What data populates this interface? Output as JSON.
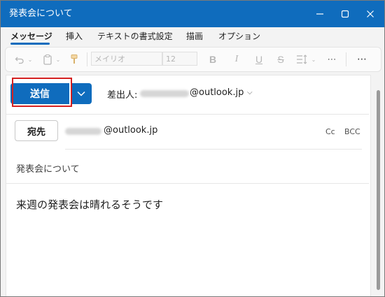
{
  "window": {
    "title": "発表会について",
    "controls": [
      "minimize-icon",
      "maximize-icon",
      "close-icon"
    ]
  },
  "menu": {
    "tabs": [
      {
        "label": "メッセージ",
        "active": true
      },
      {
        "label": "挿入"
      },
      {
        "label": "テキストの書式設定"
      },
      {
        "label": "描画"
      },
      {
        "label": "オプション"
      }
    ]
  },
  "ribbon": {
    "font_name": "メイリオ",
    "font_size": "12",
    "icons": [
      "undo-icon",
      "clipboard-icon",
      "format-painter-icon",
      "bold-icon",
      "italic-icon",
      "underline-icon",
      "strikethrough-icon",
      "line-spacing-icon",
      "more-icon",
      "more-options-icon"
    ]
  },
  "compose": {
    "send_label": "送信",
    "from_label": "差出人:",
    "from_domain": "@outlook.jp",
    "to_label": "宛先",
    "to_domain": "@outlook.jp",
    "cc_label": "Cc",
    "bcc_label": "BCC",
    "subject": "発表会について",
    "body": "来週の発表会は晴れるそうです"
  },
  "colors": {
    "accent": "#0f6cbd",
    "highlight": "#d42020"
  }
}
